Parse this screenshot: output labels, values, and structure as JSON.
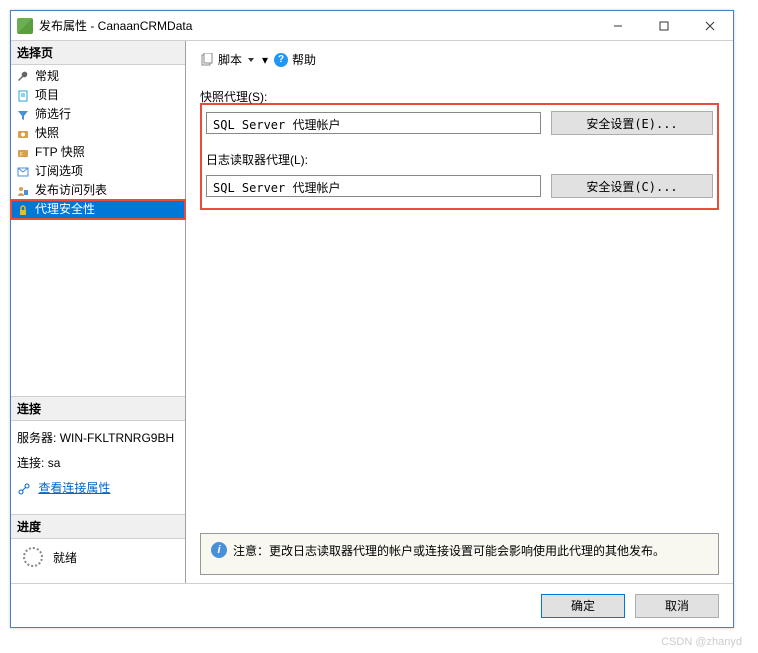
{
  "window": {
    "title": "发布属性 - CanaanCRMData"
  },
  "sidebar": {
    "select_page_header": "选择页",
    "items": [
      {
        "label": "常规"
      },
      {
        "label": "项目"
      },
      {
        "label": "筛选行"
      },
      {
        "label": "快照"
      },
      {
        "label": "FTP 快照"
      },
      {
        "label": "订阅选项"
      },
      {
        "label": "发布访问列表"
      },
      {
        "label": "代理安全性"
      }
    ],
    "connection": {
      "header": "连接",
      "server_label": "服务器:",
      "server_value": "WIN-FKLTRNRG9BH",
      "conn_label": "连接:",
      "conn_value": "sa",
      "view_link": "查看连接属性"
    },
    "progress": {
      "header": "进度",
      "status": "就绪"
    }
  },
  "toolbar": {
    "script_label": "脚本",
    "help_label": "帮助"
  },
  "form": {
    "snapshot": {
      "label": "快照代理(S):",
      "value": "SQL Server 代理帐户",
      "button": "安全设置(E)..."
    },
    "logreader": {
      "label": "日志读取器代理(L):",
      "value": "SQL Server 代理帐户",
      "button": "安全设置(C)..."
    }
  },
  "notice": {
    "prefix": "注意：",
    "text": "更改日志读取器代理的帐户或连接设置可能会影响使用此代理的其他发布。"
  },
  "footer": {
    "ok": "确定",
    "cancel": "取消"
  },
  "watermark": "CSDN @zhanyd"
}
